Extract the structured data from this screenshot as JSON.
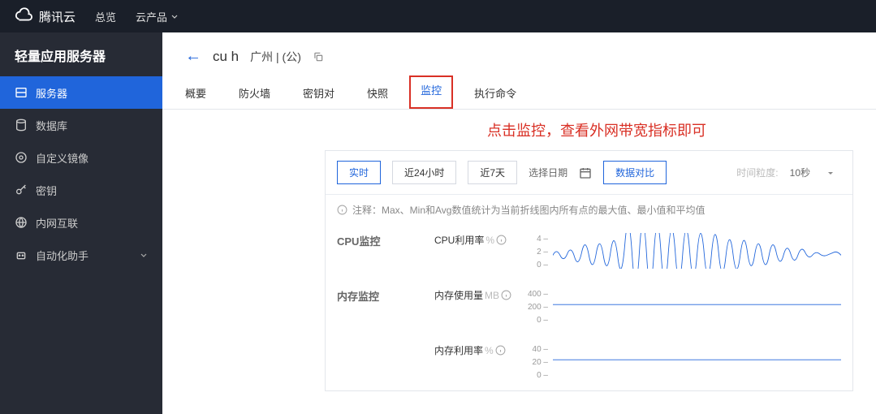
{
  "topbar": {
    "brand": "腾讯云",
    "overview": "总览",
    "products": "云产品"
  },
  "sidebar": {
    "title": "轻量应用服务器",
    "items": [
      {
        "label": "服务器",
        "icon": "server"
      },
      {
        "label": "数据库",
        "icon": "db"
      },
      {
        "label": "自定义镜像",
        "icon": "disc"
      },
      {
        "label": "密钥",
        "icon": "key"
      },
      {
        "label": "内网互联",
        "icon": "net"
      },
      {
        "label": "自动化助手",
        "icon": "robot",
        "expandable": true
      }
    ]
  },
  "breadcrumb": {
    "name": "cu    h",
    "region": "广州 | (公)"
  },
  "tabs": [
    {
      "label": "概要"
    },
    {
      "label": "防火墙"
    },
    {
      "label": "密钥对"
    },
    {
      "label": "快照"
    },
    {
      "label": "监控",
      "active": true,
      "boxed": true
    },
    {
      "label": "执行命令"
    }
  ],
  "hint": "点击监控，查看外网带宽指标即可",
  "toolbar": {
    "realtime": "实时",
    "d1": "近24小时",
    "d7": "近7天",
    "pick": "选择日期",
    "compare": "数据对比",
    "gran_label": "时间粒度:",
    "gran_value": "10秒"
  },
  "note": "注释：Max、Min和Avg数值统计为当前折线图内所有点的最大值、最小值和平均值",
  "sections": {
    "cpu": "CPU监控",
    "mem": "内存监控"
  },
  "metrics": {
    "cpu": "CPU利用率",
    "cpu_unit": "%",
    "mem_use": "内存使用量",
    "mem_unit": "MB",
    "mem_rate": "内存利用率"
  },
  "chart_data": [
    {
      "type": "line",
      "title": "CPU利用率%",
      "ylim": [
        0,
        4
      ],
      "y_ticks": [
        0,
        2,
        4
      ],
      "values_approx": "oscillating 1-3%"
    },
    {
      "type": "line",
      "title": "内存使用量MB",
      "ylim": [
        0,
        400
      ],
      "y_ticks": [
        0,
        200,
        400
      ],
      "values_approx": "flat ~180"
    },
    {
      "type": "line",
      "title": "内存利用率%",
      "ylim": [
        0,
        40
      ],
      "y_ticks": [
        0,
        20,
        40
      ],
      "values_approx": "flat ~18"
    }
  ]
}
